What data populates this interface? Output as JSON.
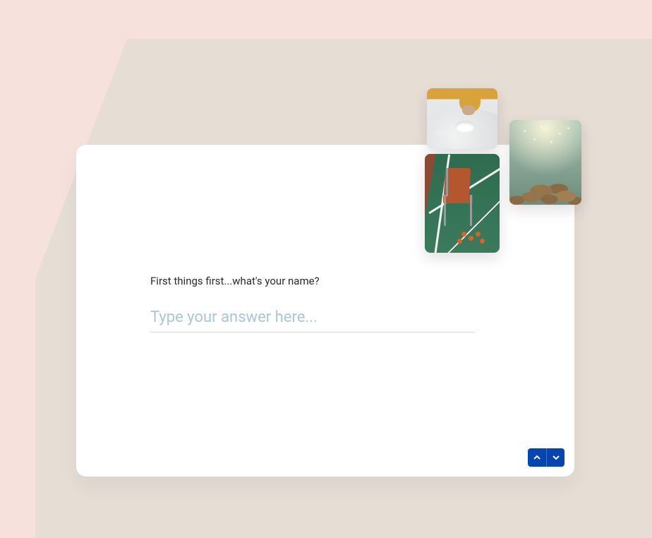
{
  "question": {
    "prompt": "First things first...what's your name?",
    "placeholder": "Type your answer here...",
    "value": ""
  },
  "nav": {
    "prev_label": "Previous",
    "next_label": "Next"
  },
  "images": [
    {
      "name": "egg-marble-table-photo"
    },
    {
      "name": "chair-tennis-court-photo"
    },
    {
      "name": "underwater-coral-photo"
    }
  ],
  "colors": {
    "page_bg": "#f7e1dd",
    "band_bg": "#e6ddd5",
    "card_bg": "#ffffff",
    "accent": "#0445af",
    "placeholder": "#a8c6e2"
  }
}
